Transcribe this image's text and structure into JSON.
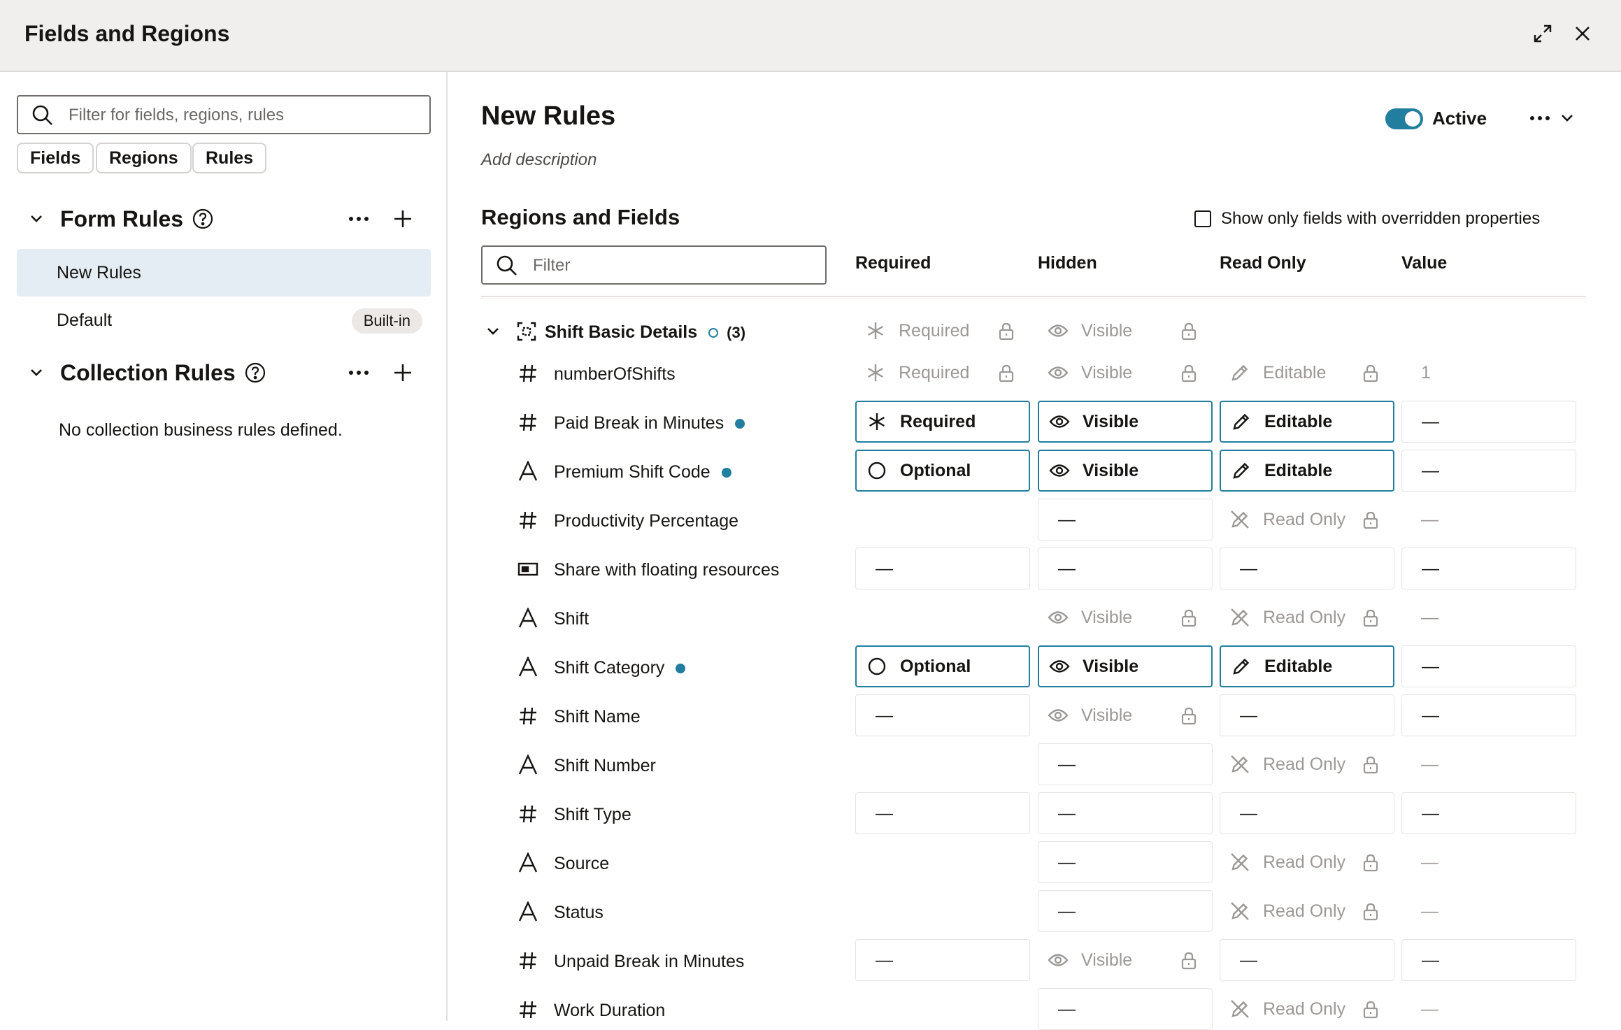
{
  "header": {
    "title": "Fields and Regions"
  },
  "left": {
    "search_placeholder": "Filter for fields, regions, rules",
    "chips": [
      "Fields",
      "Regions",
      "Rules"
    ],
    "form_rules": {
      "title": "Form Rules",
      "items": [
        {
          "label": "New Rules",
          "selected": true
        },
        {
          "label": "Default",
          "badge": "Built-in"
        }
      ]
    },
    "collection_rules": {
      "title": "Collection Rules",
      "empty": "No collection business rules defined."
    }
  },
  "main": {
    "title": "New Rules",
    "description": "Add description",
    "active_label": "Active",
    "section_title": "Regions and Fields",
    "checkbox_label": "Show only fields with overridden properties",
    "filter_placeholder": "Filter",
    "columns": [
      "Required",
      "Hidden",
      "Read Only",
      "Value"
    ],
    "region": {
      "label": "Shift Basic Details",
      "count": "(3)",
      "required": "Required",
      "hidden": "Visible"
    },
    "rows": [
      {
        "type": "number",
        "label": "numberOfShifts",
        "dot": false,
        "required": "Required",
        "hidden": "Visible",
        "readonly": "Editable",
        "value": "1"
      },
      {
        "type": "number",
        "label": "Paid Break in Minutes",
        "dot": true,
        "required": "Required",
        "hidden": "Visible",
        "readonly": "Editable",
        "value": "—"
      },
      {
        "type": "text",
        "label": "Premium Shift Code",
        "dot": true,
        "required": "Optional",
        "hidden": "Visible",
        "readonly": "Editable",
        "value": "—"
      },
      {
        "type": "number",
        "label": "Productivity Percentage",
        "dot": false,
        "required": "",
        "hidden": "—",
        "readonly": "Read Only",
        "value": "—"
      },
      {
        "type": "checkbox",
        "label": "Share with floating resources",
        "dot": false,
        "required": "—",
        "hidden": "—",
        "readonly": "—",
        "value": "—"
      },
      {
        "type": "text",
        "label": "Shift",
        "dot": false,
        "required": "",
        "hidden": "Visible",
        "readonly": "Read Only",
        "value": "—"
      },
      {
        "type": "text",
        "label": "Shift Category",
        "dot": true,
        "required": "Optional",
        "hidden": "Visible",
        "readonly": "Editable",
        "value": "—"
      },
      {
        "type": "number",
        "label": "Shift Name",
        "dot": false,
        "required": "—",
        "hidden": "Visible",
        "readonly": "—",
        "value": "—"
      },
      {
        "type": "text",
        "label": "Shift Number",
        "dot": false,
        "required": "",
        "hidden": "—",
        "readonly": "Read Only",
        "value": "—"
      },
      {
        "type": "number",
        "label": "Shift Type",
        "dot": false,
        "required": "—",
        "hidden": "—",
        "readonly": "—",
        "value": "—"
      },
      {
        "type": "text",
        "label": "Source",
        "dot": false,
        "required": "",
        "hidden": "—",
        "readonly": "Read Only",
        "value": "—"
      },
      {
        "type": "text",
        "label": "Status",
        "dot": false,
        "required": "",
        "hidden": "—",
        "readonly": "Read Only",
        "value": "—"
      },
      {
        "type": "number",
        "label": "Unpaid Break in Minutes",
        "dot": false,
        "required": "—",
        "hidden": "Visible",
        "readonly": "—",
        "value": "—"
      },
      {
        "type": "number",
        "label": "Work Duration",
        "dot": false,
        "required": "",
        "hidden": "—",
        "readonly": "Read Only",
        "value": "—"
      }
    ]
  },
  "colors": {
    "accent": "#227e9e",
    "header_bg": "#f1efed",
    "selected_bg": "#e4edf3"
  }
}
